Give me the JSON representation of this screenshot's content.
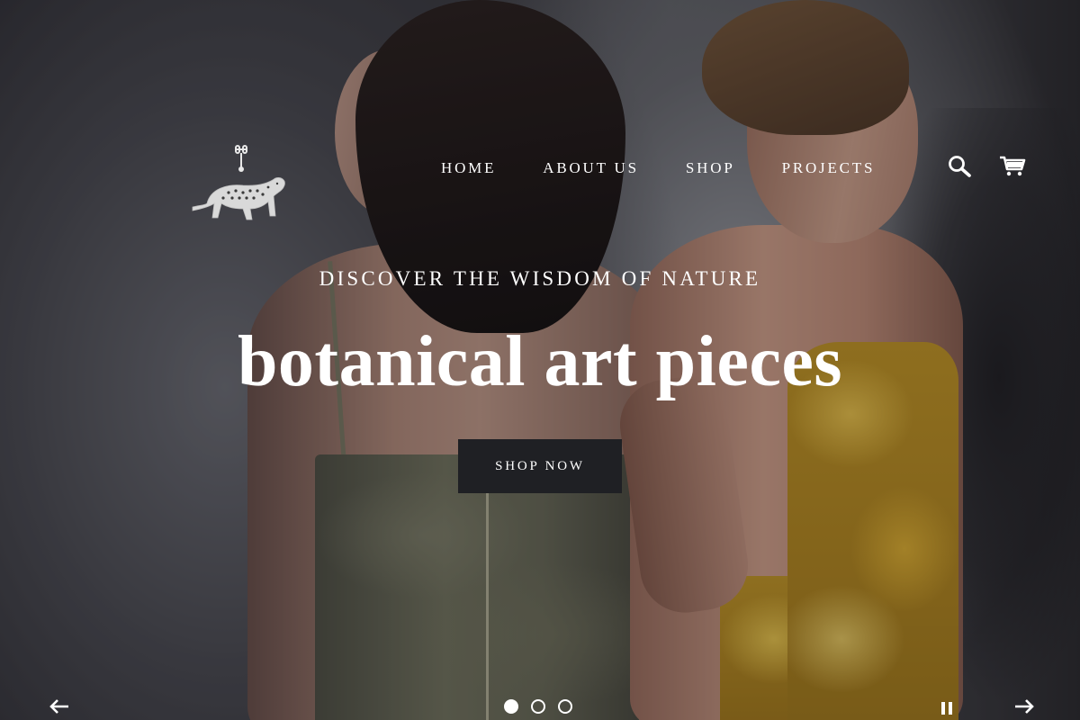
{
  "header": {
    "logo_alt": "leopard logo",
    "nav": [
      {
        "label": "HOME"
      },
      {
        "label": "ABOUT US"
      },
      {
        "label": "SHOP"
      },
      {
        "label": "PROJECTS"
      }
    ],
    "icons": {
      "search": "search-icon",
      "cart": "cart-icon"
    }
  },
  "hero": {
    "eyebrow": "DISCOVER THE WISDOM OF NATURE",
    "headline": "botanical art pieces",
    "cta_label": "SHOP NOW",
    "cta_bg": "#1f2024"
  },
  "slideshow": {
    "prev_icon": "arrow-left-icon",
    "next_icon": "arrow-right-icon",
    "pause_icon": "pause-icon",
    "slide_count": 3,
    "active_slide": 1
  },
  "colors": {
    "text": "#ffffff",
    "button": "#1f2024"
  }
}
